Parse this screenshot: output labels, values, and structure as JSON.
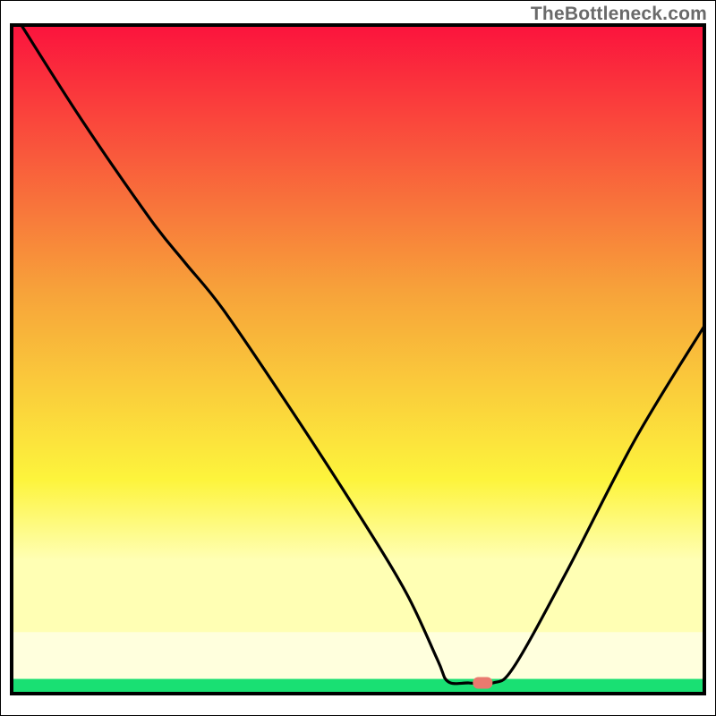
{
  "watermark": "TheBottleneck.com",
  "colors": {
    "frame_stroke": "#000000",
    "curve": "#000000",
    "marker": "#e97a6f",
    "gradient_top": "#fb133d",
    "gradient_mid1": "#f7a33a",
    "gradient_mid2": "#fdf43c",
    "gradient_low": "#ffffb4",
    "green_band": "#19e073",
    "white_band_top": "#ffffff"
  },
  "chart_data": {
    "type": "line",
    "title": "",
    "xlabel": "",
    "ylabel": "",
    "xlim": [
      0,
      100
    ],
    "ylim": [
      0,
      100
    ],
    "grid": false,
    "legend": false,
    "axes_visible": false,
    "background": "vertical red→yellow→green gradient (bottleneck severity)",
    "curve_points": [
      {
        "x": 1.4,
        "y": 100.0
      },
      {
        "x": 10.0,
        "y": 86.0
      },
      {
        "x": 20.0,
        "y": 71.0
      },
      {
        "x": 25.0,
        "y": 64.5
      },
      {
        "x": 30.5,
        "y": 57.5
      },
      {
        "x": 40.0,
        "y": 43.0
      },
      {
        "x": 50.0,
        "y": 27.0
      },
      {
        "x": 57.0,
        "y": 15.0
      },
      {
        "x": 61.5,
        "y": 5.0
      },
      {
        "x": 63.0,
        "y": 1.8
      },
      {
        "x": 66.0,
        "y": 1.6
      },
      {
        "x": 69.5,
        "y": 1.6
      },
      {
        "x": 72.5,
        "y": 4.0
      },
      {
        "x": 80.0,
        "y": 18.0
      },
      {
        "x": 90.0,
        "y": 38.0
      },
      {
        "x": 100.0,
        "y": 55.0
      }
    ],
    "optimal_marker": {
      "x": 68.0,
      "y": 1.6
    },
    "green_band_y": [
      0.0,
      2.2
    ]
  }
}
